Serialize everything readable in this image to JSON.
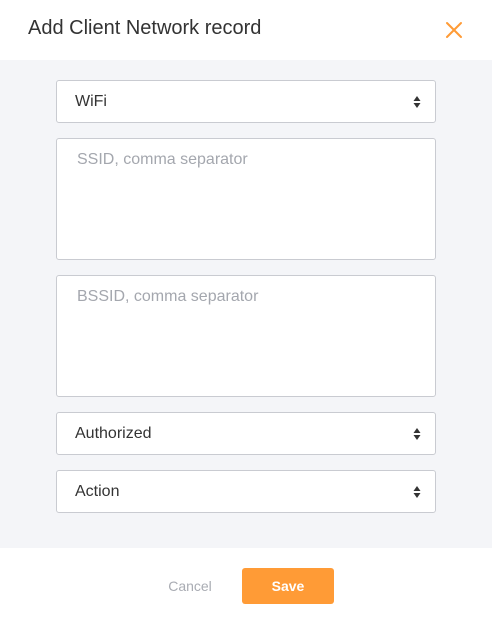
{
  "dialog": {
    "title": "Add Client Network record",
    "close_icon": "close-icon",
    "accent_color": "#ff9b36"
  },
  "form": {
    "network_type_select": {
      "value": "WiFi",
      "icon": "select-arrows-icon"
    },
    "ssid_field": {
      "value": "",
      "placeholder": "SSID, comma separator"
    },
    "bssid_field": {
      "value": "",
      "placeholder": "BSSID, comma separator"
    },
    "authorization_select": {
      "value": "Authorized",
      "icon": "select-arrows-icon"
    },
    "action_select": {
      "value": "Action",
      "icon": "select-arrows-icon"
    }
  },
  "footer": {
    "cancel_label": "Cancel",
    "save_label": "Save"
  }
}
